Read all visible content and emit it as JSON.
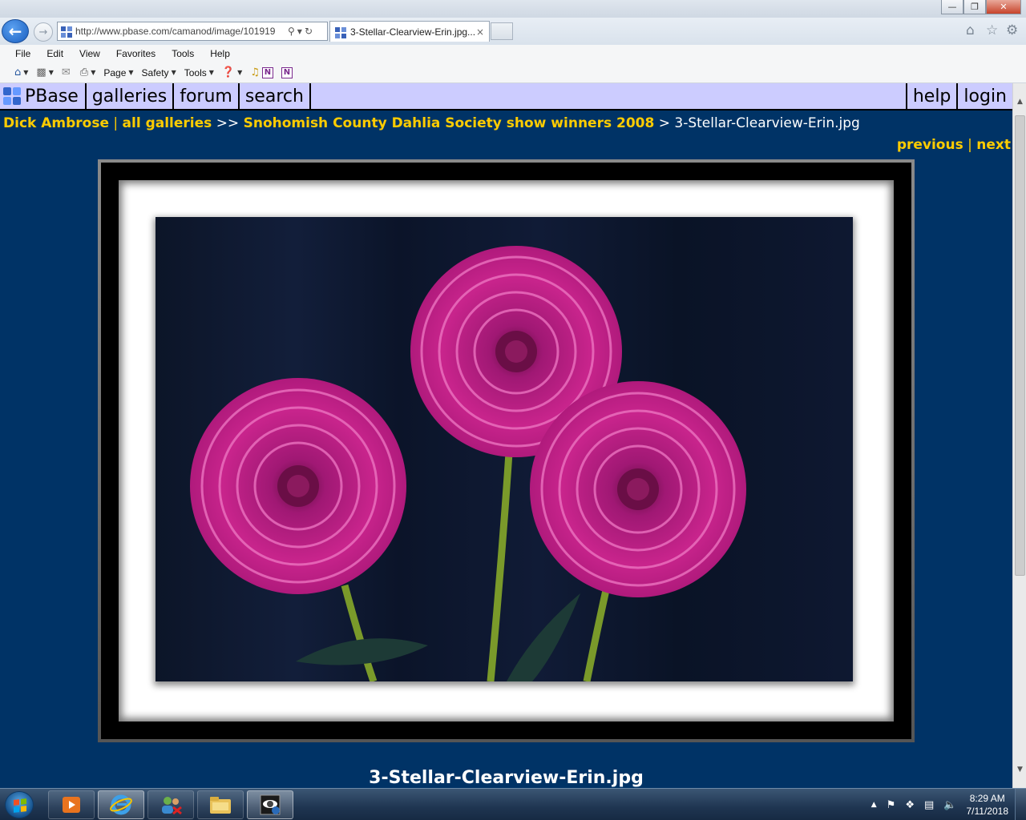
{
  "browser": {
    "url": "http://www.pbase.com/camanod/image/101919",
    "tab_title": "3-Stellar-Clearview-Erin.jpg...",
    "tab_close": "×",
    "menu": [
      "File",
      "Edit",
      "View",
      "Favorites",
      "Tools",
      "Help"
    ],
    "commands": {
      "page": "Page",
      "safety": "Safety",
      "tools": "Tools"
    }
  },
  "site_nav": {
    "logo": "PBase",
    "items": [
      "galleries",
      "forum",
      "search"
    ],
    "right_items": [
      "help",
      "login"
    ]
  },
  "breadcrumb": {
    "owner": "Dick Ambrose",
    "sep1": "|",
    "all_galleries": "all galleries",
    "sep2": ">>",
    "gallery": "Snohomish County Dahlia Society show winners 2008",
    "sep3": ">",
    "current": "3-Stellar-Clearview-Erin.jpg"
  },
  "pager": {
    "previous": "previous",
    "sep": "|",
    "next": "next"
  },
  "image": {
    "alt": "Three magenta dahlia blooms on green stems against dark blue background",
    "caption": "3-Stellar-Clearview-Erin.jpg"
  },
  "taskbar": {
    "time": "8:29 AM",
    "date": "7/11/2018"
  },
  "colors": {
    "page_bg": "#003366",
    "nav_bg": "#ccccff",
    "link": "#ffcc00",
    "dahlia": "#c8248c"
  }
}
